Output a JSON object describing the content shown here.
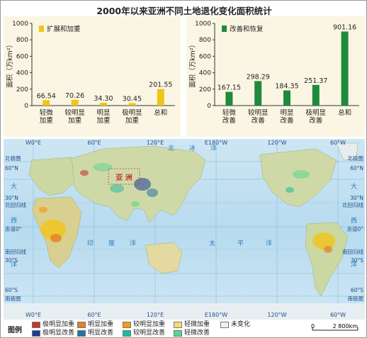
{
  "title": "2000年以来亚洲不同土地退化变化面积统计",
  "chart_data": [
    {
      "type": "bar",
      "ylabel": "面积（万km²）",
      "ylim": [
        0,
        1000
      ],
      "yticks": [
        0,
        200,
        400,
        600,
        800,
        1000
      ],
      "grid": false,
      "legend_position": "top-left",
      "series": [
        {
          "name": "扩展和加重",
          "color": "#f0c419",
          "values": [
            66.54,
            70.26,
            34.3,
            30.45,
            201.55
          ]
        }
      ],
      "categories": [
        "轻微\n加重",
        "较明显\n加重",
        "明显\n加重",
        "极明显\n加重",
        "总和"
      ]
    },
    {
      "type": "bar",
      "ylabel": "面积（万km²）",
      "ylim": [
        0,
        1000
      ],
      "yticks": [
        0,
        200,
        400,
        600,
        800,
        1000
      ],
      "grid": false,
      "legend_position": "top-left",
      "series": [
        {
          "name": "改善和恢复",
          "color": "#1e8a3c",
          "values": [
            167.15,
            298.29,
            184.35,
            251.37,
            901.16
          ]
        }
      ],
      "categories": [
        "轻微\n改善",
        "较明显\n改善",
        "明显\n改善",
        "极明显\n改善",
        "总和"
      ]
    }
  ],
  "value_labels": {
    "left": [
      "66.54",
      "70.26",
      "34.30",
      "30.45",
      "201.55"
    ],
    "right": [
      "167.15",
      "298.29",
      "184.35",
      "251.37",
      "901.16"
    ]
  },
  "map": {
    "top_lon_labels": [
      "W0°E",
      "60°E",
      "120°E",
      "E180°W",
      "120°W",
      "60°W"
    ],
    "bottom_lon_labels": [
      "W0°E",
      "60°E",
      "120°E",
      "E180°W",
      "120°W",
      "60°W"
    ],
    "left_lat_labels": [
      "北极圈",
      "60°N",
      "30°N",
      "北回归线",
      "赤道0°",
      "南回归线",
      "30°S",
      "60°S",
      "南极圈"
    ],
    "right_lat_labels": [
      "北极圈",
      "60°N",
      "30°N",
      "北回归线",
      "赤道0°",
      "南回归线",
      "30°S",
      "60°S",
      "南极圈"
    ],
    "ocean_labels": {
      "arctic": [
        "北",
        "冰",
        "洋"
      ],
      "indian": [
        "印",
        "度",
        "洋"
      ],
      "pacific": [
        "太",
        "平",
        "洋"
      ],
      "atlantic_left": [
        "大",
        "西",
        "洋"
      ],
      "atlantic_right": [
        "大",
        "西",
        "洋"
      ]
    },
    "region_label": "亚 洲"
  },
  "legend": {
    "title": "图例",
    "items": [
      {
        "label": "极明显加重",
        "color": "#c0392b"
      },
      {
        "label": "明显加重",
        "color": "#e67e22"
      },
      {
        "label": "较明显加重",
        "color": "#f39c12"
      },
      {
        "label": "轻微加重",
        "color": "#f7dc6f"
      },
      {
        "label": "未变化",
        "color": "#f4f1e6"
      },
      {
        "label": "极明显改善",
        "color": "#1f3a93"
      },
      {
        "label": "明显改善",
        "color": "#2471a3"
      },
      {
        "label": "较明显改善",
        "color": "#1abc9c"
      },
      {
        "label": "轻微改善",
        "color": "#58d68d"
      }
    ],
    "scale_zero": "0",
    "scale_text": "2 800km"
  }
}
